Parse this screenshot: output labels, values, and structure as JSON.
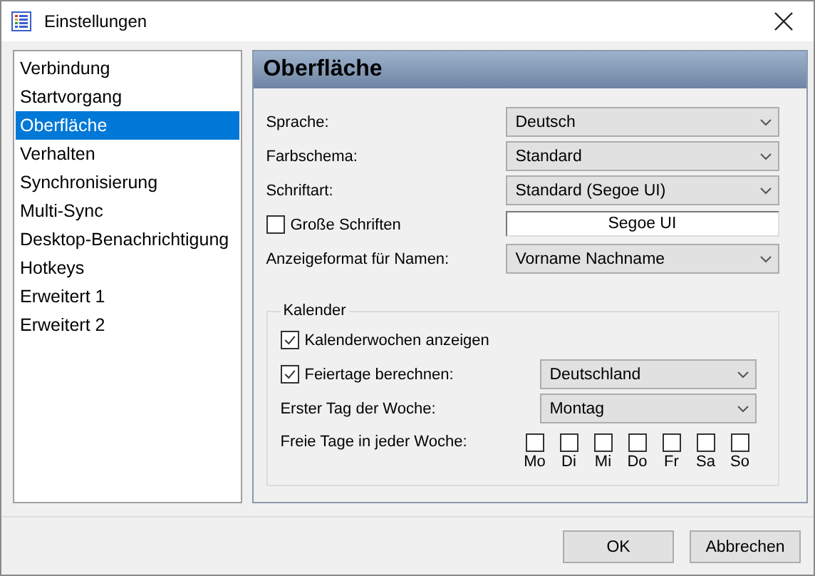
{
  "window": {
    "title": "Einstellungen"
  },
  "sidebar": {
    "items": [
      {
        "label": "Verbindung",
        "selected": false
      },
      {
        "label": "Startvorgang",
        "selected": false
      },
      {
        "label": "Oberfläche",
        "selected": true
      },
      {
        "label": "Verhalten",
        "selected": false
      },
      {
        "label": "Synchronisierung",
        "selected": false
      },
      {
        "label": "Multi-Sync",
        "selected": false
      },
      {
        "label": "Desktop-Benachrichtigung",
        "selected": false
      },
      {
        "label": "Hotkeys",
        "selected": false
      },
      {
        "label": "Erweitert 1",
        "selected": false
      },
      {
        "label": "Erweitert 2",
        "selected": false
      }
    ]
  },
  "panel": {
    "title": "Oberfläche",
    "rows": [
      {
        "kind": "select",
        "label": "Sprache:",
        "value": "Deutsch"
      },
      {
        "kind": "select",
        "label": "Farbschema:",
        "value": "Standard"
      },
      {
        "kind": "select",
        "label": "Schriftart:",
        "value": "Standard (Segoe UI)"
      },
      {
        "kind": "checkbox_field",
        "label": "Große Schriften",
        "checked": false,
        "value": "Segoe UI"
      },
      {
        "kind": "select",
        "label": "Anzeigeformat für Namen:",
        "value": "Vorname Nachname"
      }
    ],
    "calendar": {
      "title": "Kalender",
      "rows": [
        {
          "kind": "checkbox",
          "label": "Kalenderwochen anzeigen",
          "checked": true
        },
        {
          "kind": "checkbox_select",
          "label": "Feiertage berechnen:",
          "checked": true,
          "value": "Deutschland"
        },
        {
          "kind": "select",
          "label": "Erster Tag der Woche:",
          "value": "Montag"
        },
        {
          "kind": "days",
          "label": "Freie Tage in jeder Woche:",
          "days": [
            {
              "label": "Mo",
              "checked": false
            },
            {
              "label": "Di",
              "checked": false
            },
            {
              "label": "Mi",
              "checked": false
            },
            {
              "label": "Do",
              "checked": false
            },
            {
              "label": "Fr",
              "checked": false
            },
            {
              "label": "Sa",
              "checked": false
            },
            {
              "label": "So",
              "checked": false
            }
          ]
        }
      ]
    }
  },
  "buttons": [
    {
      "label": "OK"
    },
    {
      "label": "Abbrechen"
    }
  ]
}
